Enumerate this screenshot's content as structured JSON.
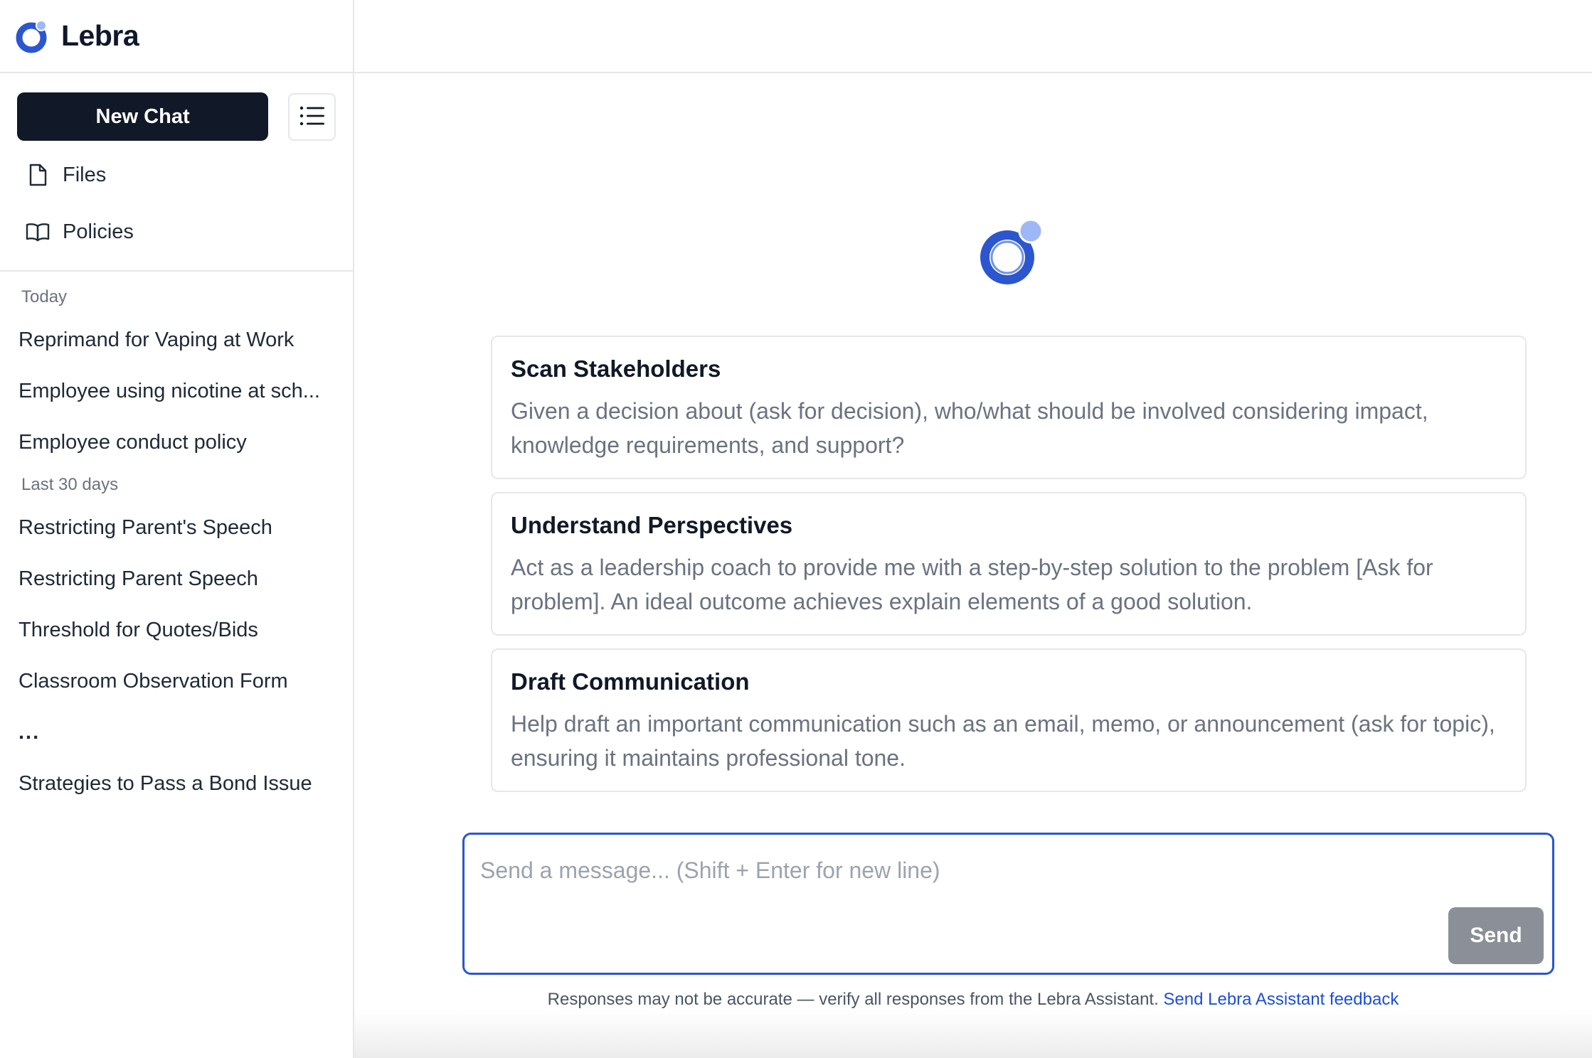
{
  "brand": {
    "name": "Lebra"
  },
  "colors": {
    "accent": "#2b56cf",
    "accent_light": "#9db8f5",
    "primary_button": "#111827",
    "send_disabled": "#8b8f97",
    "link": "#1d4ed8"
  },
  "sidebar": {
    "new_chat_label": "New Chat",
    "menu_icon": "list-icon",
    "nav": [
      {
        "label": "Files",
        "icon": "file-icon"
      },
      {
        "label": "Policies",
        "icon": "book-icon"
      }
    ],
    "sections": [
      {
        "label": "Today",
        "items": [
          "Reprimand for Vaping at Work",
          "Employee using nicotine at sch...",
          "Employee conduct policy"
        ]
      },
      {
        "label": "Last 30 days",
        "items": [
          "Restricting Parent's Speech",
          "Restricting Parent Speech",
          "Threshold for Quotes/Bids",
          "Classroom Observation Form",
          "...",
          "Strategies to Pass a Bond Issue"
        ]
      }
    ]
  },
  "main": {
    "cards": [
      {
        "title": "Scan Stakeholders",
        "description": "Given a decision about (ask for decision), who/what should be involved considering impact, knowledge requirements, and support?"
      },
      {
        "title": "Understand Perspectives",
        "description": "Act as a leadership coach to provide me with a step-by-step solution to the problem [Ask for problem]. An ideal outcome achieves explain elements of a good solution."
      },
      {
        "title": "Draft Communication",
        "description": "Help draft an important communication such as an email, memo, or announcement (ask for topic), ensuring it maintains professional tone."
      }
    ],
    "composer": {
      "placeholder": "Send a message... (Shift + Enter for new line)",
      "value": "",
      "send_label": "Send"
    },
    "disclaimer": {
      "text": "Responses may not be accurate — verify all responses from the Lebra Assistant. ",
      "link_label": "Send Lebra Assistant feedback"
    }
  }
}
